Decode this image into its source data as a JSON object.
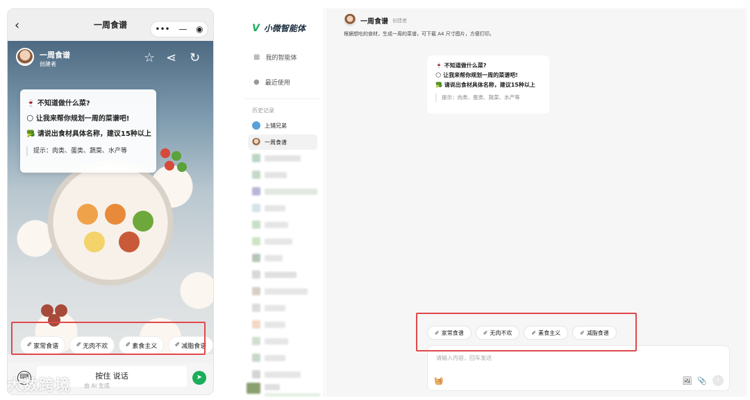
{
  "mobile": {
    "back_icon": "‹",
    "title": "一周食谱",
    "capsule_more": "•••",
    "capsule_min": "—",
    "capsule_close": "◉",
    "agent": {
      "name": "一周食谱",
      "role": "创建者"
    },
    "header_icons": {
      "star": "☆",
      "share": "⋖",
      "refresh": "↻"
    },
    "prompt": {
      "line1": "🍷 不知道做什么菜?",
      "line2": "🌕 让我来帮你规划一周的菜谱吧!",
      "line3": "🥦 请说出食材具体名称，建议15种以上",
      "hint": "提示：肉类、蛋类、蔬菜、水产等"
    },
    "chips": [
      "家常食谱",
      "无肉不欢",
      "素食主义",
      "减脂食谱"
    ],
    "chip_icon": "✐",
    "keyboard_icon": "⌨",
    "hold_to_talk": "按住 说话",
    "send_icon": "➤",
    "ai_note": "由 AI 生成"
  },
  "watermark": "大数跨境",
  "desktop": {
    "brand_logo": "V",
    "brand_name": "小微智能体",
    "nav": [
      {
        "icon": "▦",
        "label": "我的智能体"
      },
      {
        "icon": "●",
        "label": "最近使用"
      }
    ],
    "history_title": "历史记录",
    "history": [
      {
        "label": "上铺兄弟"
      },
      {
        "label": "一周食谱"
      }
    ],
    "main": {
      "agent_name": "一周食谱",
      "agent_role": "创建者",
      "description": "根据想吃的食材，生成一周的菜谱，可下载 A4 尺寸图片，方便打印。",
      "prompt": {
        "line1": "🍷 不知道做什么菜?",
        "line2": "🌕 让我来帮你规划一周的菜谱吧!",
        "line3": "🥦 请说出食材具体名称，建议15种以上",
        "hint": "提示：肉类、蛋类、蔬菜、水产等"
      },
      "chips": [
        "家常食谱",
        "无肉不欢",
        "素食主义",
        "减脂食谱"
      ],
      "input_placeholder": "请输入内容，回车发送",
      "basket_icon": "🧺",
      "image_icon": "🖼",
      "attach_icon": "📎",
      "send_icon": "↑"
    }
  },
  "colors": {
    "accent_green": "#1aad5a",
    "highlight_red": "#e0474a"
  }
}
